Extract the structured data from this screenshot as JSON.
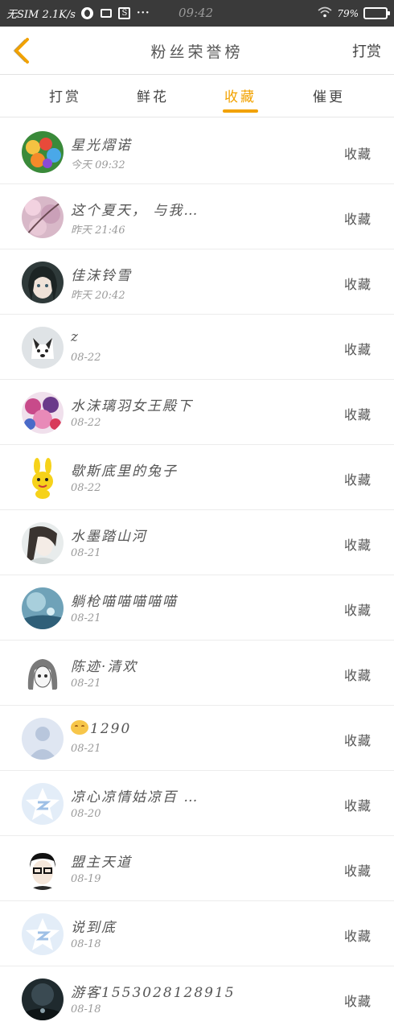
{
  "status_bar": {
    "carrier": "无SIM 2.1K/s",
    "time": "09:42",
    "battery": "79%",
    "battery_level": 0.79,
    "overflow": "···"
  },
  "header": {
    "title": "粉丝荣誉榜",
    "action": "打赏",
    "back_icon": "chevron-left-icon",
    "accent": "#f2a200"
  },
  "tabs": [
    {
      "label": "打赏",
      "active": false
    },
    {
      "label": "鲜花",
      "active": false
    },
    {
      "label": "收藏",
      "active": true
    },
    {
      "label": "催更",
      "active": false
    }
  ],
  "list": [
    {
      "name": "星光熠诺",
      "time": "今天 09:32",
      "kind": "收藏",
      "avatar": "cartoon-group"
    },
    {
      "name": "这个夏天， 与我…",
      "time": "昨天 21:46",
      "kind": "收藏",
      "avatar": "cherry-blossom"
    },
    {
      "name": "佳沫铃雪",
      "time": "昨天 20:42",
      "kind": "收藏",
      "avatar": "anime-girl-dark"
    },
    {
      "name": "z",
      "time": "08-22",
      "kind": "收藏",
      "avatar": "husky-dog"
    },
    {
      "name": "水沫璃羽女王殿下",
      "time": "08-22",
      "kind": "收藏",
      "avatar": "anime-group-pink"
    },
    {
      "name": "歇斯底里的兔子",
      "time": "08-22",
      "kind": "收藏",
      "avatar": "yellow-rabbit"
    },
    {
      "name": "水墨踏山河",
      "time": "08-21",
      "kind": "收藏",
      "avatar": "ink-portrait"
    },
    {
      "name": "躺枪喵喵喵喵喵",
      "time": "08-21",
      "kind": "收藏",
      "avatar": "blue-scene"
    },
    {
      "name": "陈迹·清欢",
      "time": "08-21",
      "kind": "收藏",
      "avatar": "sketch-girl"
    },
    {
      "name": "1290",
      "time": "08-21",
      "kind": "收藏",
      "avatar": "default-person",
      "emoji": true
    },
    {
      "name": "凉心凉情姑凉百 …",
      "time": "08-20",
      "kind": "收藏",
      "avatar": "qq-star"
    },
    {
      "name": "盟主天道",
      "time": "08-19",
      "kind": "收藏",
      "avatar": "glasses-boy"
    },
    {
      "name": "说到底",
      "time": "08-18",
      "kind": "收藏",
      "avatar": "qq-star"
    },
    {
      "name": "游客1553028128915",
      "time": "08-18",
      "kind": "收藏",
      "avatar": "dark-night"
    }
  ]
}
